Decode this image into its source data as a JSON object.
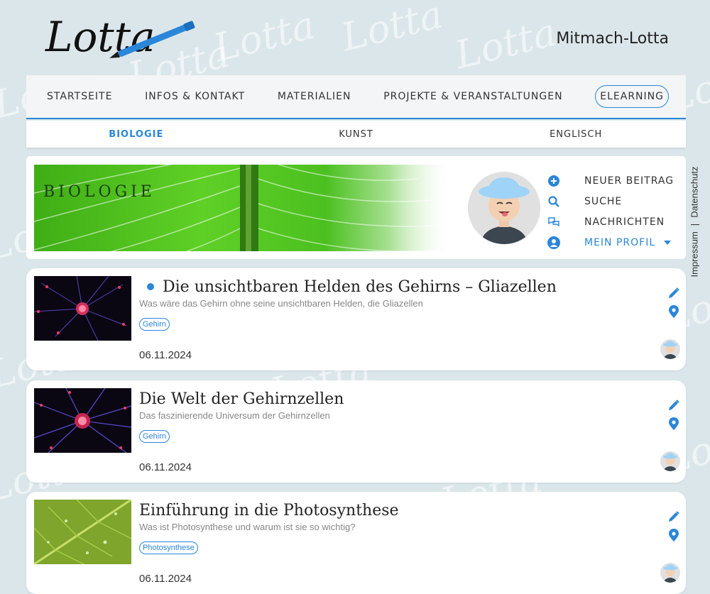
{
  "brand": {
    "logo_text": "Lotta",
    "site_title": "Mitmach-Lotta",
    "watermark": "Lotta"
  },
  "main_nav": [
    {
      "label": "STARTSEITE"
    },
    {
      "label": "INFOS & KONTAKT"
    },
    {
      "label": "MATERIALIEN"
    },
    {
      "label": "PROJEKTE & VERANSTALTUNGEN"
    },
    {
      "label": "ELEARNING"
    }
  ],
  "sub_nav": [
    {
      "label": "BIOLOGIE",
      "active": true
    },
    {
      "label": "KUNST"
    },
    {
      "label": "ENGLISCH"
    }
  ],
  "banner": {
    "title": "BIOLOGIE"
  },
  "actions": {
    "new_post": "NEUER BEITRAG",
    "search": "SUCHE",
    "messages": "NACHRICHTEN",
    "profile": "MEIN PROFIL"
  },
  "side_links": {
    "impressum": "Impressum",
    "separator": "|",
    "datenschutz": "Datenschutz"
  },
  "posts": [
    {
      "title": "Die unsichtbaren Helden des Gehirns – Gliazellen",
      "subtitle": "Was wäre das Gehirn ohne seine unsichtbaren Helden, die Gliazellen",
      "tag": "Gehirn",
      "date": "06.11.2024",
      "unread": true
    },
    {
      "title": "Die Welt der Gehirnzellen",
      "subtitle": "Das faszinierende Universum der Gehirnzellen",
      "tag": "Gehirn",
      "date": "06.11.2024"
    },
    {
      "title": "Einführung in die Photosynthese",
      "subtitle": "Was ist Photosynthese und warum ist sie so wichtig?",
      "tag": "Photosynthese",
      "date": "06.11.2024"
    }
  ],
  "colors": {
    "accent": "#2a86d9",
    "background": "#dbe6ea"
  }
}
